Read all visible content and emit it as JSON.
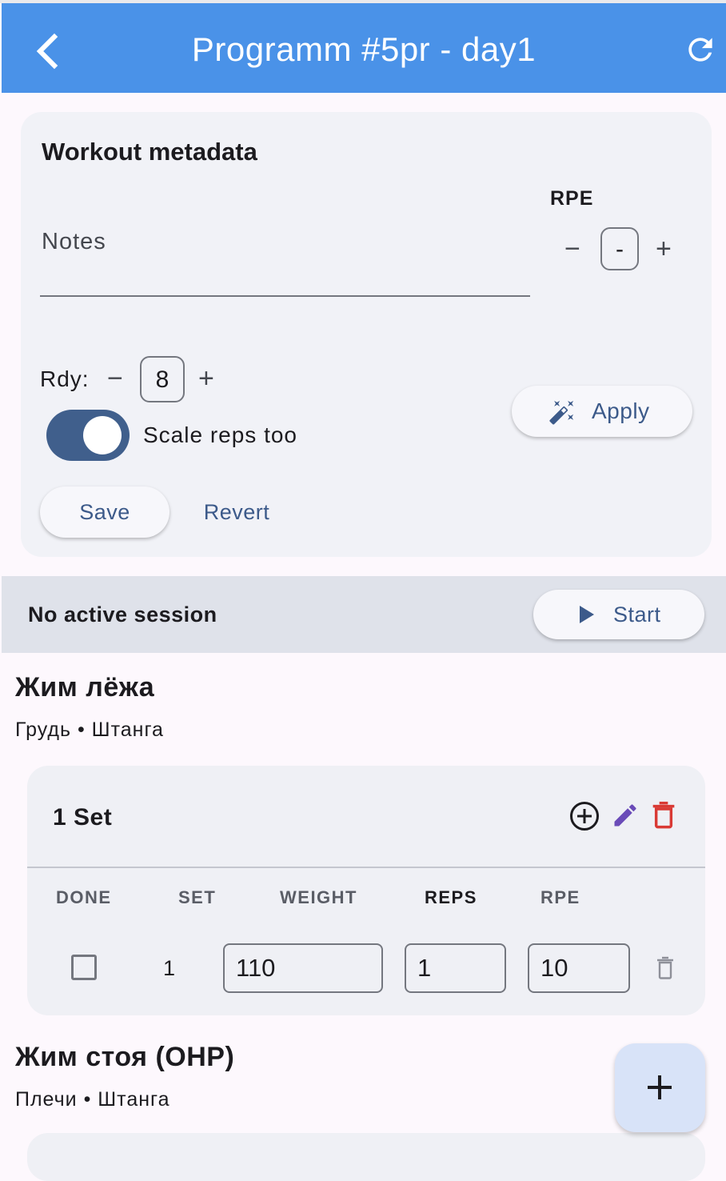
{
  "appbar": {
    "title": "Programm #5pr - day1",
    "back_icon": "arrow-back-icon",
    "refresh_icon": "refresh-icon",
    "color": "#4a92e8"
  },
  "metadata": {
    "title": "Workout metadata",
    "notes": {
      "placeholder": "Notes",
      "value": ""
    },
    "rpe": {
      "label": "RPE",
      "value": "-",
      "minus": "−",
      "plus": "+"
    },
    "rdy": {
      "label": "Rdy:",
      "value": "8",
      "minus": "−",
      "plus": "+"
    },
    "scale_reps": {
      "label": "Scale reps too",
      "checked": true
    },
    "apply_label": "Apply",
    "apply_icon": "magic-wand-icon",
    "save_label": "Save",
    "revert_label": "Revert"
  },
  "session": {
    "status": "No active session",
    "start_label": "Start",
    "start_icon": "play-icon"
  },
  "exercises": [
    {
      "title": "Жим лёжа",
      "subtitle": "Грудь • Штанга",
      "set_card": {
        "title": "1 Set",
        "columns": [
          "DONE",
          "SET",
          "WEIGHT",
          "REPS",
          "RPE"
        ],
        "rows": [
          {
            "done": false,
            "set": "1",
            "weight": "110",
            "reps": "1",
            "rpe": "10"
          }
        ]
      }
    },
    {
      "title": "Жим стоя (OHP)",
      "subtitle": "Плечи • Штанга"
    }
  ],
  "fab": {
    "icon": "add-icon",
    "color": "#d8e3f8"
  },
  "colors": {
    "accent": "#3c5a8a",
    "delete": "#d93a35",
    "edit": "#6a4bb8",
    "toggle": "#405f8c"
  }
}
